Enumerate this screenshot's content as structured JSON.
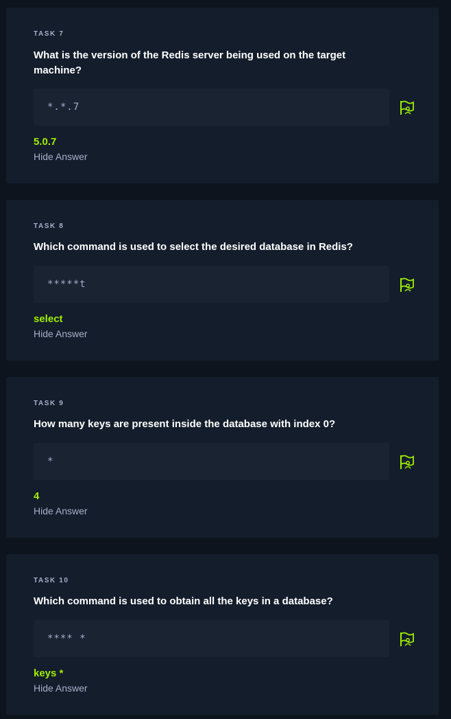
{
  "tasks": [
    {
      "label": "TASK 7",
      "question": "What is the version of the Redis server being used on the target machine?",
      "mask": "*.*.7",
      "answer": "5.0.7",
      "hide_label": "Hide Answer",
      "flag_icon": "flag-icon"
    },
    {
      "label": "TASK 8",
      "question": "Which command is used to select the desired database in Redis?",
      "mask": "*****t",
      "answer": "select",
      "hide_label": "Hide Answer",
      "flag_icon": "flag-icon"
    },
    {
      "label": "TASK 9",
      "question": "How many keys are present inside the database with index 0?",
      "mask": "*",
      "answer": "4",
      "hide_label": "Hide Answer",
      "flag_icon": "flag-icon"
    },
    {
      "label": "TASK 10",
      "question": "Which command is used to obtain all the keys in a database?",
      "mask": "**** *",
      "answer": "keys *",
      "hide_label": "Hide Answer",
      "flag_icon": "flag-icon"
    }
  ],
  "colors": {
    "background": "#0e141d",
    "card": "#141d2b",
    "input": "#1a2332",
    "accent": "#9fef00",
    "muted": "#a4b1cd",
    "text": "#ffffff"
  }
}
